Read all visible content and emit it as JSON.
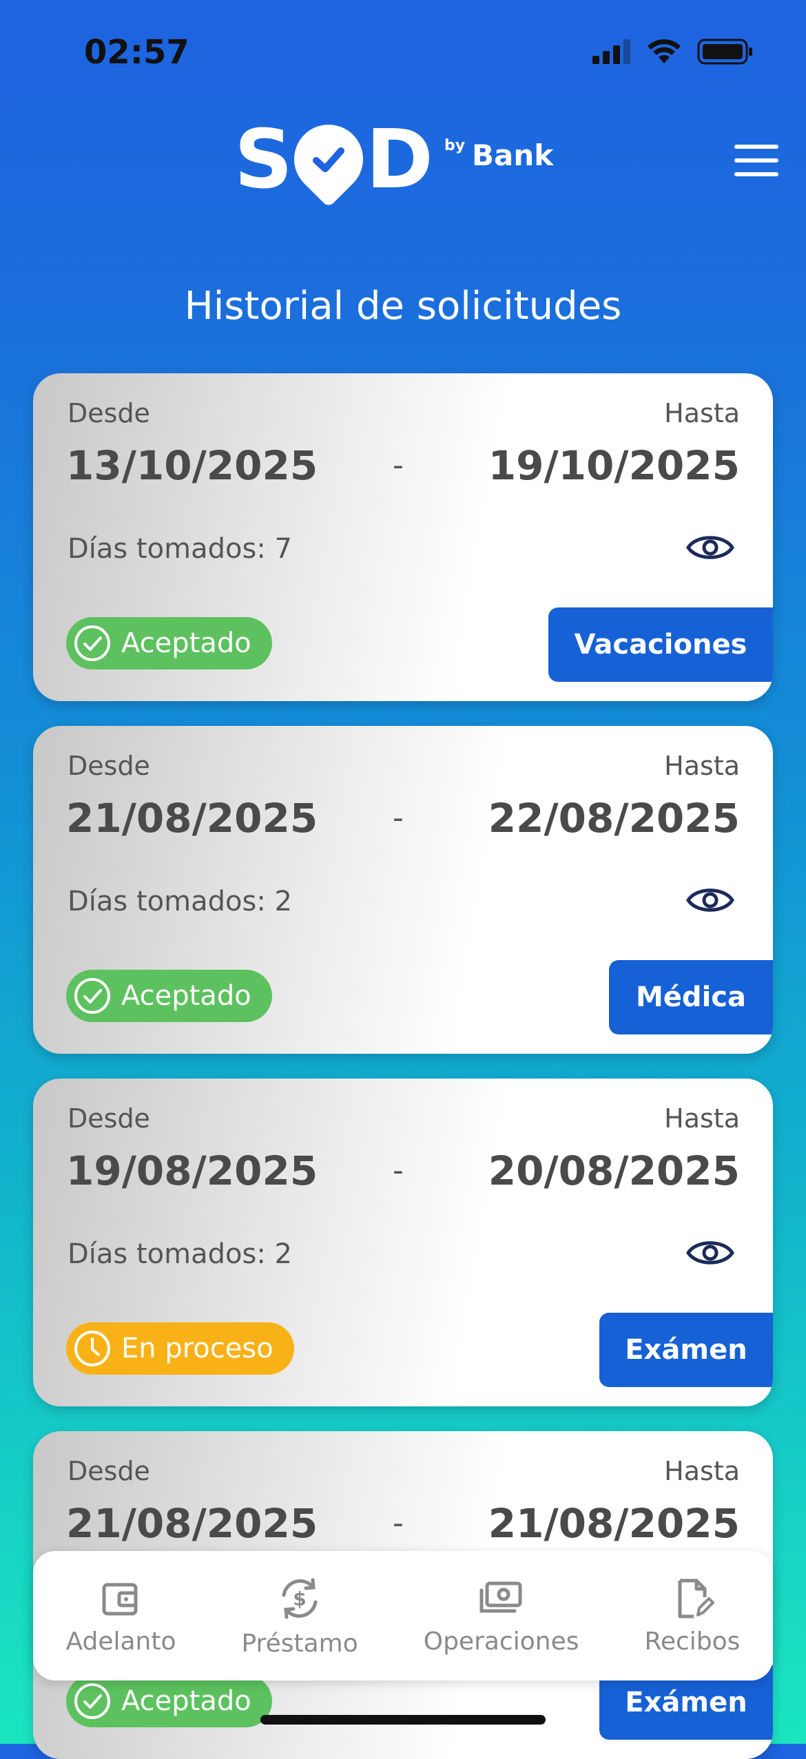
{
  "status_bar": {
    "time": "02:57"
  },
  "header": {
    "logo_text_left": "S",
    "logo_text_right": "D",
    "logo_by": "by",
    "logo_bank": "Bank"
  },
  "page_title": "Historial de solicitudes",
  "labels": {
    "desde": "Desde",
    "hasta": "Hasta",
    "dash": "-"
  },
  "requests": [
    {
      "desde": "13/10/2025",
      "hasta": "19/10/2025",
      "dias": "Días tomados: 7",
      "status": "Aceptado",
      "type": "Vacaciones"
    },
    {
      "desde": "21/08/2025",
      "hasta": "22/08/2025",
      "dias": "Días tomados: 2",
      "status": "Aceptado",
      "type": "Médica"
    },
    {
      "desde": "19/08/2025",
      "hasta": "20/08/2025",
      "dias": "Días tomados: 2",
      "status": "En proceso",
      "type": "Exámen"
    },
    {
      "desde": "21/08/2025",
      "hasta": "21/08/2025",
      "dias": "",
      "status": "Aceptado",
      "type": "Exámen"
    }
  ],
  "bottom_nav": [
    {
      "label": "Adelanto",
      "icon": "wallet-icon"
    },
    {
      "label": "Préstamo",
      "icon": "loan-cycle-icon"
    },
    {
      "label": "Operaciones",
      "icon": "cash-icon"
    },
    {
      "label": "Recibos",
      "icon": "document-edit-icon"
    }
  ],
  "colors": {
    "accepted": "#5CC15E",
    "in_process": "#F8B117",
    "type_button": "#1661D6"
  }
}
